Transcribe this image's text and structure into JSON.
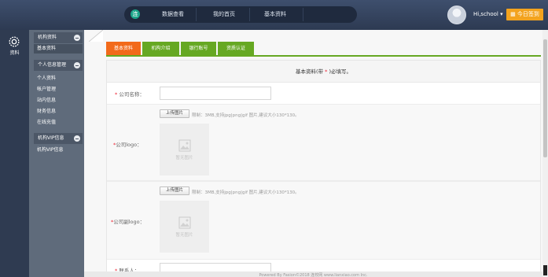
{
  "header": {
    "logo_glyph": "连",
    "nav": [
      "数据查看",
      "我的首页",
      "基本资料"
    ],
    "user_label": "Hi,school ▾",
    "checkin_label": "今日签到",
    "checkin_icon": "calendar-icon"
  },
  "iconbar": {
    "icon": "gear-icon",
    "label": "资料"
  },
  "sidebar": {
    "groups": [
      {
        "title": "机构资料",
        "items": [
          "基本资料"
        ]
      },
      {
        "title": "个人信息管理",
        "items": [
          "个人资料",
          "帐户管理",
          "站内信息",
          "财务信息",
          "在线充值"
        ]
      },
      {
        "title": "机构VIP信息",
        "items": [
          "机构VIP信息"
        ]
      }
    ]
  },
  "tabs": [
    "基本资料",
    "机构介绍",
    "银行账号",
    "资质认证"
  ],
  "form": {
    "notice_before": "基本资料(带",
    "notice_star": " * ",
    "notice_after": ")必填写。",
    "company_name_label": "公司名称：",
    "logo_label": "公司logo：",
    "sublogo_label": "公司副logo：",
    "contact_label": "联系人：",
    "upload_button": "上传图片",
    "upload_hint": "限制：3MB,支持jpg|png|gif 图片,建议大小130*130。",
    "no_image": "暂无图片"
  },
  "footer": {
    "text": "Powered By Fasion©2018 连校网 www.lianxiao.com Inc."
  },
  "colors": {
    "tab_active": "#f26a1b",
    "tab": "#66a823",
    "checkin": "#f3a31e",
    "required": "#e22233"
  }
}
